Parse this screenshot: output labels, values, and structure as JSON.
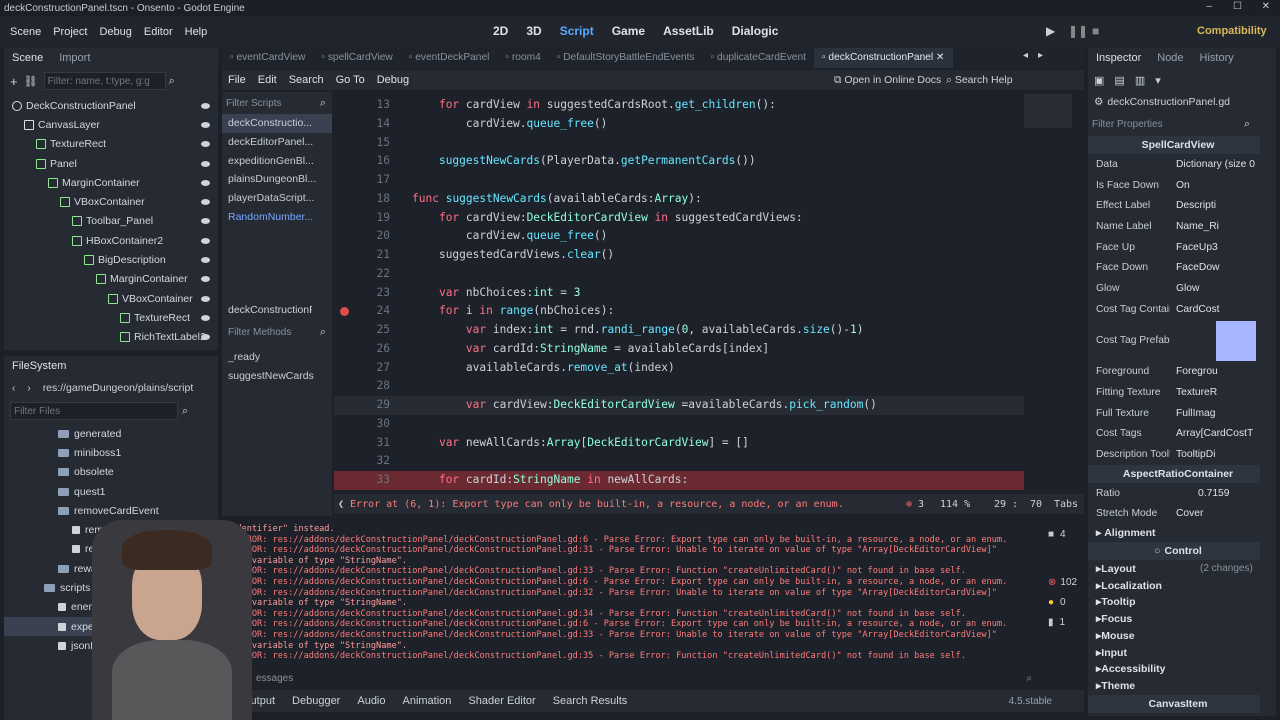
{
  "window": {
    "title": "deckConstructionPanel.tscn - Onsento - Godot Engine",
    "controls": [
      "–",
      "☐",
      "✕"
    ]
  },
  "menu": [
    "Scene",
    "Project",
    "Debug",
    "Editor",
    "Help"
  ],
  "workspaces": [
    {
      "label": "2D"
    },
    {
      "label": "3D"
    },
    {
      "label": "Script"
    },
    {
      "label": "Game"
    },
    {
      "label": "AssetLib"
    },
    {
      "label": "Dialogic"
    }
  ],
  "renderer": "Compatibility",
  "scene_dock": {
    "tabs": [
      "Scene",
      "Import"
    ],
    "filter_placeholder": "Filter: name, t:type, g:g",
    "nodes": [
      {
        "label": "DeckConstructionPanel",
        "indent": 0
      },
      {
        "label": "CanvasLayer",
        "indent": 1
      },
      {
        "label": "TextureRect",
        "indent": 2
      },
      {
        "label": "Panel",
        "indent": 2
      },
      {
        "label": "MarginContainer",
        "indent": 3
      },
      {
        "label": "VBoxContainer",
        "indent": 4
      },
      {
        "label": "Toolbar_Panel",
        "indent": 5
      },
      {
        "label": "HBoxContainer2",
        "indent": 5
      },
      {
        "label": "BigDescription",
        "indent": 6
      },
      {
        "label": "MarginContainer",
        "indent": 7
      },
      {
        "label": "VBoxContainer",
        "indent": 8
      },
      {
        "label": "TextureRect",
        "indent": 9
      },
      {
        "label": "RichTextLabel2",
        "indent": 9
      }
    ]
  },
  "filesystem": {
    "tab": "FileSystem",
    "path": "res://gameDungeon/plains/script",
    "filter_placeholder": "Filter Files",
    "items": [
      {
        "label": "generated",
        "indent": 1,
        "type": "folder"
      },
      {
        "label": "miniboss1",
        "indent": 1,
        "type": "folder"
      },
      {
        "label": "obsolete",
        "indent": 1,
        "type": "folder"
      },
      {
        "label": "quest1",
        "indent": 1,
        "type": "folder"
      },
      {
        "label": "removeCardEvent",
        "indent": 1,
        "type": "folder"
      },
      {
        "label": "removeCar",
        "indent": 2,
        "type": "file"
      },
      {
        "label": "remove",
        "indent": 2,
        "type": "file"
      },
      {
        "label": "reward",
        "indent": 1,
        "type": "folder"
      },
      {
        "label": "scripts",
        "indent": 0,
        "type": "folder"
      },
      {
        "label": "enemy",
        "indent": 1,
        "type": "file"
      },
      {
        "label": "expeditio",
        "indent": 1,
        "type": "file"
      },
      {
        "label": "jsonDun",
        "indent": 1,
        "type": "file"
      }
    ]
  },
  "script_tabs": [
    "eventCardView",
    "spellCardView",
    "eventDeckPanel",
    "room4",
    "DefaultStoryBattleEndEvents",
    "duplicateCardEvent",
    "deckConstructionPanel"
  ],
  "script_menu": [
    "File",
    "Edit",
    "Search",
    "Go To",
    "Debug"
  ],
  "script_links": [
    "Open in Online Docs",
    "Search Help"
  ],
  "script_list": {
    "filter_placeholder": "Filter Scripts",
    "items": [
      "deckConstructio...",
      "deckEditorPanel...",
      "expeditionGenBl...",
      "plainsDungeonBl...",
      "playerDataScript...",
      "RandomNumber..."
    ],
    "current": "deckConstructionF",
    "methods_placeholder": "Filter Methods",
    "methods": [
      "_ready",
      "suggestNewCards"
    ]
  },
  "code": [
    {
      "n": "13",
      "t": "\tfor cardView in suggestedCardsRoot.get_children():"
    },
    {
      "n": "14",
      "t": "\t\tcardView.queue_free()"
    },
    {
      "n": "15",
      "t": "\t"
    },
    {
      "n": "16",
      "t": "\tsuggestNewCards(PlayerData.getPermanentCards())"
    },
    {
      "n": "17",
      "t": ""
    },
    {
      "n": "18",
      "t": "func suggestNewCards(availableCards:Array):"
    },
    {
      "n": "19",
      "t": "\tfor cardView:DeckEditorCardView in suggestedCardViews:"
    },
    {
      "n": "20",
      "t": "\t\tcardView.queue_free()"
    },
    {
      "n": "21",
      "t": "\tsuggestedCardViews.clear()"
    },
    {
      "n": "22",
      "t": "\t"
    },
    {
      "n": "23",
      "t": "\tvar nbChoices:int = 3"
    },
    {
      "n": "24",
      "t": "\tfor i in range(nbChoices):"
    },
    {
      "n": "25",
      "t": "\t\tvar index:int = rnd.randi_range(0, availableCards.size()-1)"
    },
    {
      "n": "26",
      "t": "\t\tvar cardId:StringName = availableCards[index]"
    },
    {
      "n": "27",
      "t": "\t\tavailableCards.remove_at(index)"
    },
    {
      "n": "28",
      "t": "\t\t"
    },
    {
      "n": "29",
      "t": "\t\tvar cardView:DeckEditorCardView =availableCards.pick_random()"
    },
    {
      "n": "30",
      "t": "\t"
    },
    {
      "n": "31",
      "t": "\tvar newAllCards:Array[DeckEditorCardView] = []"
    },
    {
      "n": "32",
      "t": "\t"
    },
    {
      "n": "33",
      "t": "\tfor cardId:StringName in newAllCards:"
    }
  ],
  "status": {
    "error": "Error at (6, 1): Export type can only be built-in, a resource, a node, or an enum.",
    "error_count": "3",
    "zoom": "114 %",
    "position": "29 :",
    "column": "70",
    "indent": "Tabs"
  },
  "output": [
    {
      "t": "\"Identifier\" instead.",
      "e": false
    },
    {
      "t": "● ERROR: res://addons/deckConstructionPanel/deckConstructionPanel.gd:6 - Parse Error: Export type can only be built-in, a resource, a node, or an enum.",
      "e": true
    },
    {
      "t": "● ERROR: res://addons/deckConstructionPanel/deckConstructionPanel.gd:31 - Parse Error: Unable to iterate on value of type \"Array[DeckEditorCardView]\"",
      "e": true
    },
    {
      "t": "with variable of type \"StringName\".",
      "e": false
    },
    {
      "t": "● ERROR: res://addons/deckConstructionPanel/deckConstructionPanel.gd:33 - Parse Error: Function \"createUnlimitedCard()\" not found in base self.",
      "e": true
    },
    {
      "t": "● ERROR: res://addons/deckConstructionPanel/deckConstructionPanel.gd:6 - Parse Error: Export type can only be built-in, a resource, a node, or an enum.",
      "e": true
    },
    {
      "t": "● ERROR: res://addons/deckConstructionPanel/deckConstructionPanel.gd:32 - Parse Error: Unable to iterate on value of type \"Array[DeckEditorCardView]\"",
      "e": true
    },
    {
      "t": "with variable of type \"StringName\".",
      "e": false
    },
    {
      "t": "● ERROR: res://addons/deckConstructionPanel/deckConstructionPanel.gd:34 - Parse Error: Function \"createUnlimitedCard()\" not found in base self.",
      "e": true
    },
    {
      "t": "● ERROR: res://addons/deckConstructionPanel/deckConstructionPanel.gd:6 - Parse Error: Export type can only be built-in, a resource, a node, or an enum.",
      "e": true
    },
    {
      "t": "● ERROR: res://addons/deckConstructionPanel/deckConstructionPanel.gd:33 - Parse Error: Unable to iterate on value of type \"Array[DeckEditorCardView]\"",
      "e": true
    },
    {
      "t": "with variable of type \"StringName\".",
      "e": false
    },
    {
      "t": "● ERROR: res://addons/deckConstructionPanel/deckConstructionPanel.gd:35 - Parse Error: Function \"createUnlimitedCard()\" not found in base self.",
      "e": true
    }
  ],
  "output_counts": {
    "a": "4",
    "errors": "102",
    "warnings": "0",
    "info": "1"
  },
  "output_filter": "essages",
  "bottom_tabs": [
    "Output",
    "Debugger",
    "Audio",
    "Animation",
    "Shader Editor",
    "Search Results"
  ],
  "version": "4.5.stable",
  "inspector": {
    "tabs": [
      "Inspector",
      "Node",
      "History"
    ],
    "resource": "deckConstructionPanel.gd",
    "filter_placeholder": "Filter Properties",
    "class": "SpellCardView",
    "props": [
      {
        "l": "Data",
        "v": "Dictionary (size 0"
      },
      {
        "l": "Is Face Down",
        "v": "On"
      },
      {
        "l": "Effect Label",
        "v": "Descripti"
      },
      {
        "l": "Name Label",
        "v": "Name_Ri"
      },
      {
        "l": "Face Up",
        "v": "FaceUp3"
      },
      {
        "l": "Face Down",
        "v": "FaceDow"
      },
      {
        "l": "Glow",
        "v": "Glow"
      },
      {
        "l": "Cost Tag Contain",
        "v": "CardCost"
      }
    ],
    "cost_tag_prefab": "Cost Tag Prefab",
    "props2": [
      {
        "l": "Foreground",
        "v": "Foregrou"
      },
      {
        "l": "Fitting Texture",
        "v": "TextureR"
      },
      {
        "l": "Full Texture",
        "v": "FullImag"
      },
      {
        "l": "Cost Tags",
        "v": "Array[CardCostT"
      },
      {
        "l": "Description Toolt",
        "v": "TooltipDi"
      }
    ],
    "aspect": "AspectRatioContainer",
    "ratio_label": "Ratio",
    "ratio": "0.7159",
    "stretch_label": "Stretch Mode",
    "stretch": "Cover",
    "alignment": "Alignment",
    "control": "Control",
    "groups": [
      {
        "l": "Layout",
        "v": "(2 changes)"
      },
      {
        "l": "Localization",
        "v": ""
      },
      {
        "l": "Tooltip",
        "v": ""
      },
      {
        "l": "Focus",
        "v": ""
      },
      {
        "l": "Mouse",
        "v": ""
      },
      {
        "l": "Input",
        "v": ""
      },
      {
        "l": "Accessibility",
        "v": ""
      },
      {
        "l": "Theme",
        "v": ""
      }
    ],
    "canvas_item": "CanvasItem"
  }
}
